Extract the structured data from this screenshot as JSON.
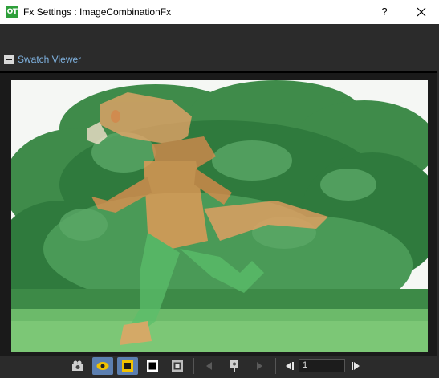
{
  "window": {
    "app_icon_text": "OT",
    "title": "Fx Settings : ImageCombinationFx",
    "help_label": "?",
    "close_icon": "close-icon"
  },
  "section": {
    "label": "Swatch Viewer",
    "collapse_icon": "minus-icon"
  },
  "viewer": {
    "content": "image"
  },
  "bottom_toolbar": {
    "buttons": [
      {
        "icon": "camera-icon",
        "active": false
      },
      {
        "icon": "eye-icon",
        "active": true
      },
      {
        "icon": "checkerboard-bg-icon",
        "active": true
      },
      {
        "icon": "black-bg-icon",
        "active": false
      },
      {
        "icon": "white-bg-icon",
        "active": false
      },
      {
        "icon": "prev-arrow-icon",
        "active": false
      },
      {
        "icon": "pin-icon",
        "active": false
      },
      {
        "icon": "next-arrow-icon",
        "active": false
      },
      {
        "icon": "step-back-icon",
        "active": false
      },
      {
        "icon": "step-forward-icon",
        "active": false
      }
    ],
    "frame_value": "1"
  },
  "colors": {
    "accent_blue": "#5c7fb0",
    "eye_yellow": "#f2c200",
    "section_label": "#7fb2e0"
  }
}
